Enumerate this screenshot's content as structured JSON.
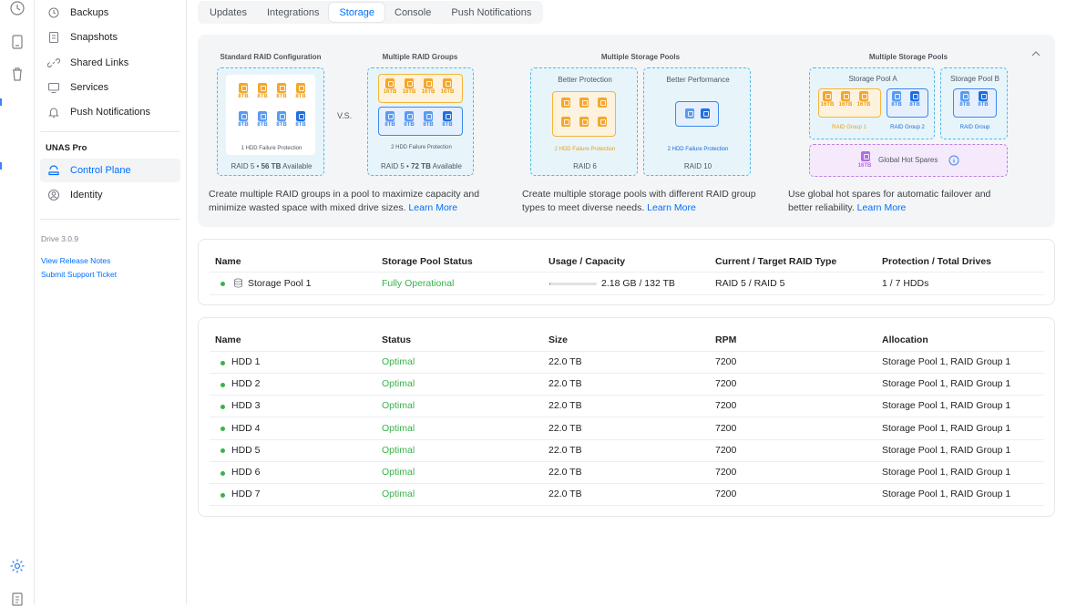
{
  "sidebar": {
    "items": [
      {
        "label": "Backups",
        "icon": "backup-icon"
      },
      {
        "label": "Snapshots",
        "icon": "snapshot-icon"
      },
      {
        "label": "Shared Links",
        "icon": "link-icon"
      },
      {
        "label": "Services",
        "icon": "monitor-icon"
      },
      {
        "label": "Push Notifications",
        "icon": "bell-icon"
      }
    ],
    "section_title": "UNAS Pro",
    "sub_items": [
      {
        "label": "Control Plane",
        "icon": "control-plane-icon",
        "active": true
      },
      {
        "label": "Identity",
        "icon": "identity-icon",
        "active": false
      }
    ],
    "version": "Drive 3.0.9",
    "links": [
      "View Release Notes",
      "Submit Support Ticket"
    ]
  },
  "tabs": [
    {
      "label": "Updates",
      "active": false
    },
    {
      "label": "Integrations",
      "active": false
    },
    {
      "label": "Storage",
      "active": true
    },
    {
      "label": "Console",
      "active": false
    },
    {
      "label": "Push Notifications",
      "active": false
    }
  ],
  "banner": {
    "illustrations": {
      "standard_title": "Standard RAID Configuration",
      "standard_drive_label": "8TB",
      "standard_protection": "1 HDD Failure Protection",
      "standard_raid_prefix": "RAID 5 • ",
      "standard_capacity": "56 TB",
      "standard_available": " Available",
      "vs": "V.S.",
      "multi_groups_title": "Multiple RAID Groups",
      "multi_groups_big_label": "16TB",
      "multi_groups_small_label": "8TB",
      "multi_groups_protection": "2 HDD Failure Protection",
      "multi_groups_raid_prefix": "RAID 5 • ",
      "multi_groups_capacity": "72 TB",
      "multi_groups_available": " Available",
      "pools_title": "Multiple Storage Pools",
      "better_protection": "Better Protection",
      "better_performance": "Better Performance",
      "protection_failure_a": "2 HDD Failure Protection",
      "protection_failure_b": "2 HDD Failure Protection",
      "raid6": "RAID 6",
      "raid10": "RAID 10",
      "spares_title": "Multiple Storage Pools",
      "pool_a": "Storage Pool A",
      "pool_b": "Storage Pool B",
      "group1": "RAID Group 1",
      "group2": "RAID Group 2",
      "group": "RAID Group",
      "big_label": "16TB",
      "small_label": "8TB",
      "hot_spares": "Global Hot Spares",
      "hot_spare_size": "16TB"
    },
    "descriptions": [
      {
        "text": "Create multiple RAID groups in a pool to maximize capacity and minimize wasted space with mixed drive sizes. ",
        "link": "Learn More"
      },
      {
        "text": "Create multiple storage pools with different RAID group types to meet diverse needs. ",
        "link": "Learn More"
      },
      {
        "text": "Use global hot spares for automatic failover and better reliability. ",
        "link": "Learn More"
      }
    ]
  },
  "pools_table": {
    "headers": [
      "Name",
      "Storage Pool Status",
      "Usage / Capacity",
      "Current / Target RAID Type",
      "Protection / Total Drives"
    ],
    "rows": [
      {
        "name": "Storage Pool 1",
        "status": "Fully Operational",
        "usage": "2.18 GB / 132 TB",
        "usage_fraction": 0.02,
        "raid": "RAID 5 / RAID 5",
        "protection": "1 / 7 HDDs"
      }
    ]
  },
  "drives_table": {
    "headers": [
      "Name",
      "Status",
      "Size",
      "RPM",
      "Allocation"
    ],
    "rows": [
      {
        "name": "HDD 1",
        "status": "Optimal",
        "size": "22.0 TB",
        "rpm": "7200",
        "allocation": "Storage Pool 1, RAID Group 1"
      },
      {
        "name": "HDD 2",
        "status": "Optimal",
        "size": "22.0 TB",
        "rpm": "7200",
        "allocation": "Storage Pool 1, RAID Group 1"
      },
      {
        "name": "HDD 3",
        "status": "Optimal",
        "size": "22.0 TB",
        "rpm": "7200",
        "allocation": "Storage Pool 1, RAID Group 1"
      },
      {
        "name": "HDD 4",
        "status": "Optimal",
        "size": "22.0 TB",
        "rpm": "7200",
        "allocation": "Storage Pool 1, RAID Group 1"
      },
      {
        "name": "HDD 5",
        "status": "Optimal",
        "size": "22.0 TB",
        "rpm": "7200",
        "allocation": "Storage Pool 1, RAID Group 1"
      },
      {
        "name": "HDD 6",
        "status": "Optimal",
        "size": "22.0 TB",
        "rpm": "7200",
        "allocation": "Storage Pool 1, RAID Group 1"
      },
      {
        "name": "HDD 7",
        "status": "Optimal",
        "size": "22.0 TB",
        "rpm": "7200",
        "allocation": "Storage Pool 1, RAID Group 1"
      }
    ]
  },
  "colors": {
    "accent": "#006fff",
    "success": "#38b24a"
  }
}
